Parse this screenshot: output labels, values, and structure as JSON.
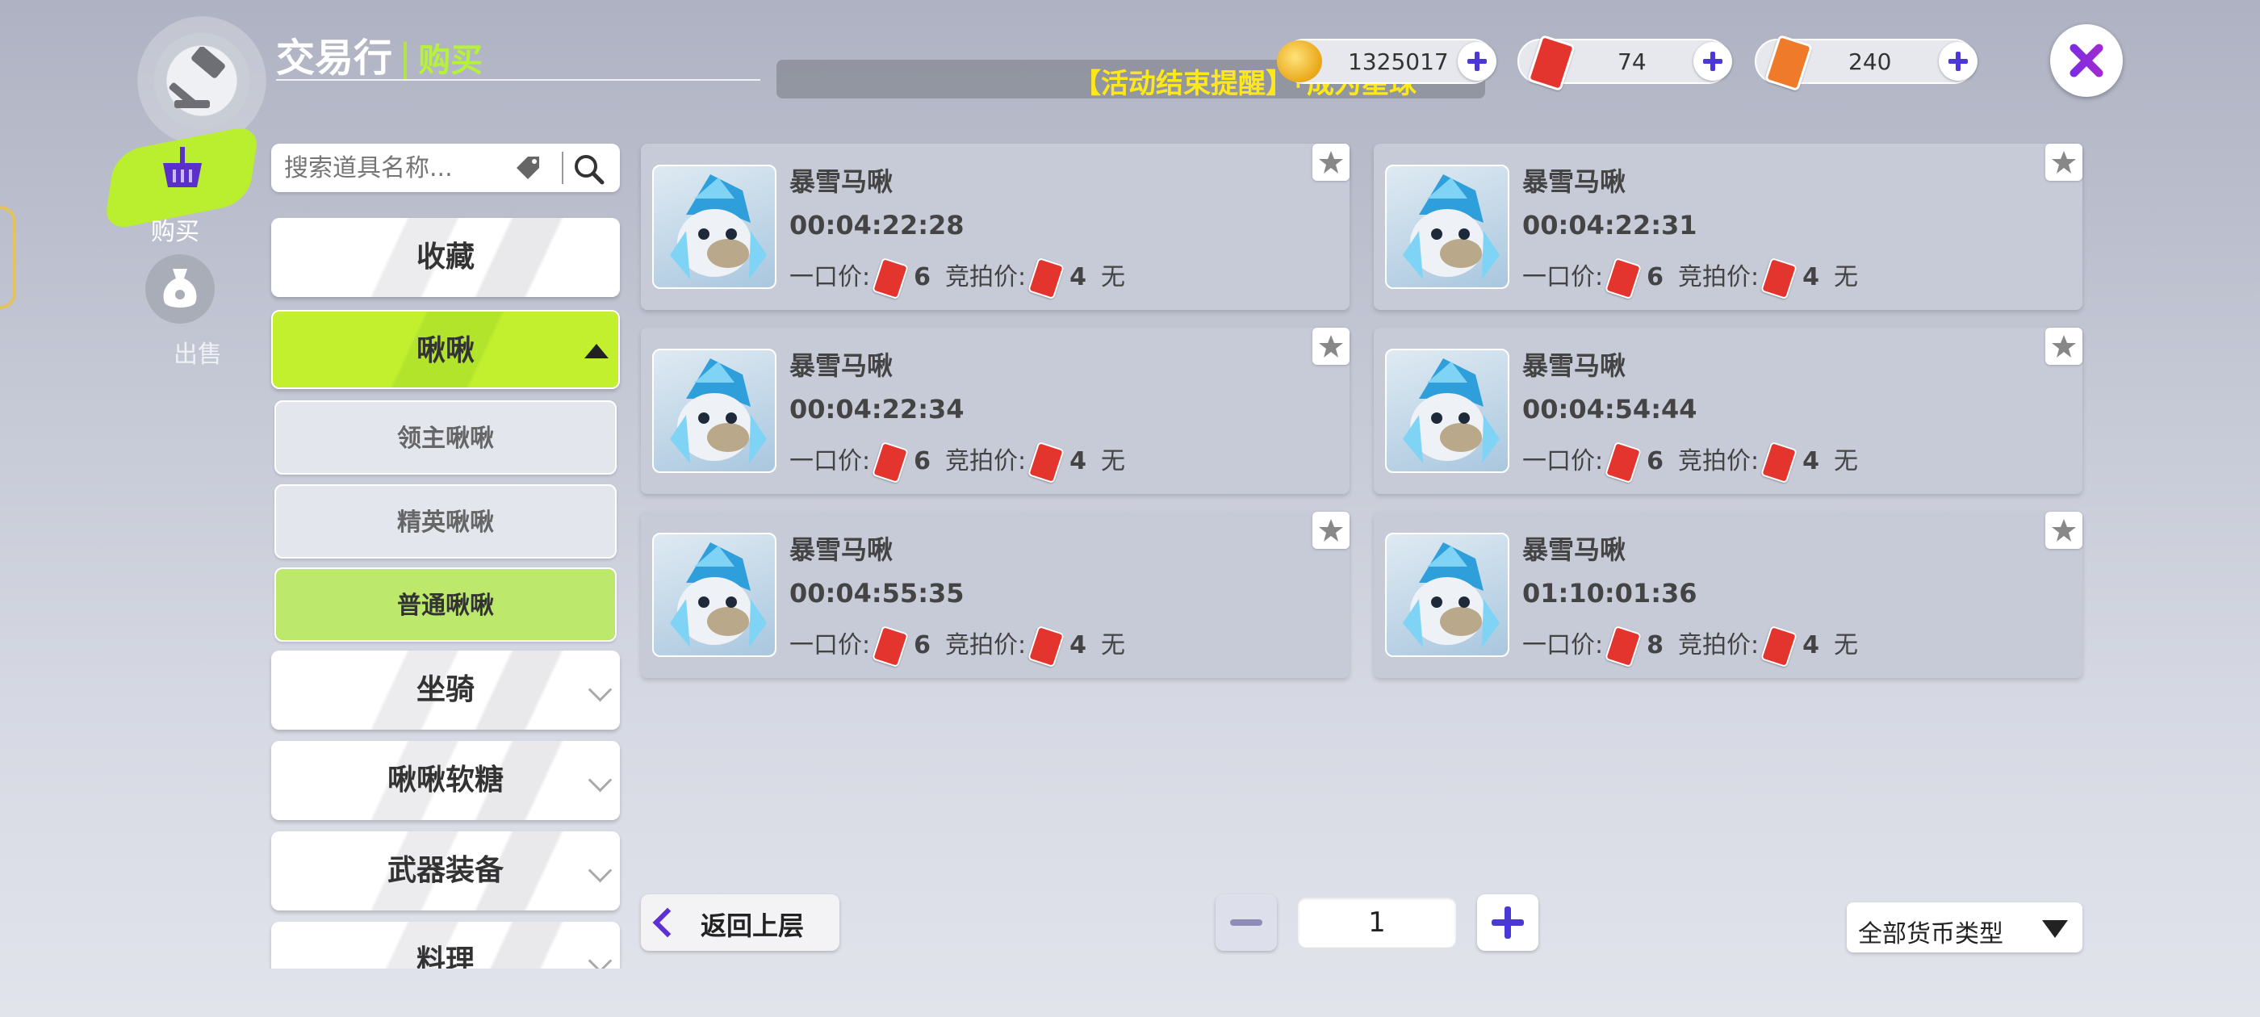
{
  "header": {
    "title": "交易行",
    "separator": "|",
    "subtitle": "购买",
    "announcement": "【活动结束提醒】「成为星球"
  },
  "currencies": [
    {
      "icon": "gold-coin-icon",
      "value": "1325017"
    },
    {
      "icon": "red-card-icon",
      "value": "74"
    },
    {
      "icon": "orange-card-icon",
      "value": "240"
    }
  ],
  "modes": {
    "buy_label": "购买",
    "sell_label": "出售"
  },
  "search": {
    "placeholder": "搜索道具名称..."
  },
  "categories": {
    "favorites": "收藏",
    "pets": "啾啾",
    "pet_sub": [
      "领主啾啾",
      "精英啾啾",
      "普通啾啾"
    ],
    "mounts": "坐骑",
    "candy": "啾啾软糖",
    "weapons": "武器装备",
    "cooking": "料理"
  },
  "listings": [
    {
      "name": "暴雪马啾",
      "timer": "00:04:22:28",
      "buyout_label": "一口价:",
      "buyout": "6",
      "bid_label": "竞拍价:",
      "bid": "4",
      "status": "无"
    },
    {
      "name": "暴雪马啾",
      "timer": "00:04:22:31",
      "buyout_label": "一口价:",
      "buyout": "6",
      "bid_label": "竞拍价:",
      "bid": "4",
      "status": "无"
    },
    {
      "name": "暴雪马啾",
      "timer": "00:04:22:34",
      "buyout_label": "一口价:",
      "buyout": "6",
      "bid_label": "竞拍价:",
      "bid": "4",
      "status": "无"
    },
    {
      "name": "暴雪马啾",
      "timer": "00:04:54:44",
      "buyout_label": "一口价:",
      "buyout": "6",
      "bid_label": "竞拍价:",
      "bid": "4",
      "status": "无"
    },
    {
      "name": "暴雪马啾",
      "timer": "00:04:55:35",
      "buyout_label": "一口价:",
      "buyout": "6",
      "bid_label": "竞拍价:",
      "bid": "4",
      "status": "无"
    },
    {
      "name": "暴雪马啾",
      "timer": "01:10:01:36",
      "buyout_label": "一口价:",
      "buyout": "8",
      "bid_label": "竞拍价:",
      "bid": "4",
      "status": "无"
    }
  ],
  "footer": {
    "back_label": "返回上层",
    "page": "1",
    "currency_filter": "全部货币类型"
  },
  "colors": {
    "accent_green": "#b9ef2e",
    "accent_purple": "#5e2fd1",
    "announcement_yellow": "#ffe81a"
  }
}
